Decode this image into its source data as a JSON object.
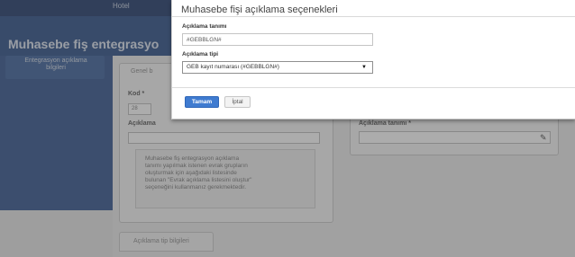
{
  "background": {
    "topbar_text": "Hotel",
    "page_title": "Muhasebe fiş entegrasyo",
    "sidebar_item": "Entegrasyon açıklama bilgileri",
    "panel_tab": "Genel b",
    "kod_label": "Kod *",
    "kod_value": "28",
    "aciklama_label": "Açıklama",
    "note_lines": [
      "Muhasebe fiş entegrasyon açıklama",
      "tanımı yapılmak istenen evrak grupların",
      "oluşturmak için aşağıdaki listesinde",
      "bulunan \"Evrak açıklama listesini oluştur\"",
      "seçeneğini kullanmanız gerekmektedir."
    ],
    "right_label": "Açıklama tanımı *",
    "tab2_label": "Açıklama tip bilgileri"
  },
  "modal": {
    "title": "Muhasebe fişi açıklama seçenekleri",
    "description_label": "Açıklama tanımı",
    "description_value": "#GEBBLGN#",
    "type_label": "Açıklama tipi",
    "type_selected": "GEB kayıt numarası (#GEBBLGN#)",
    "ok_label": "Tamam",
    "cancel_label": "İptal"
  }
}
